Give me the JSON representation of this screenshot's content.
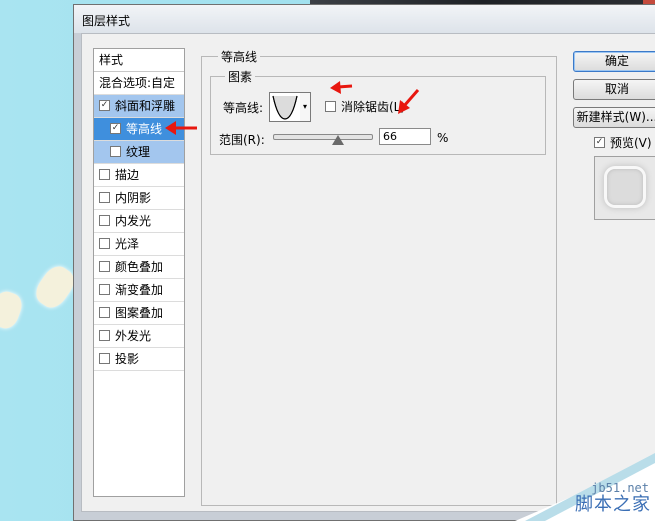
{
  "window": {
    "title": "图层样式"
  },
  "style_list": {
    "header": "样式",
    "blend_options": "混合选项:自定",
    "items": [
      {
        "label": "斜面和浮雕",
        "checked": true,
        "selected": true,
        "sub": false
      },
      {
        "label": "等高线",
        "checked": true,
        "selected": true,
        "sub": true
      },
      {
        "label": "纹理",
        "checked": false,
        "selected": true,
        "sub": true
      },
      {
        "label": "描边",
        "checked": false,
        "selected": false,
        "sub": false
      },
      {
        "label": "内阴影",
        "checked": false,
        "selected": false,
        "sub": false
      },
      {
        "label": "内发光",
        "checked": false,
        "selected": false,
        "sub": false
      },
      {
        "label": "光泽",
        "checked": false,
        "selected": false,
        "sub": false
      },
      {
        "label": "颜色叠加",
        "checked": false,
        "selected": false,
        "sub": false
      },
      {
        "label": "渐变叠加",
        "checked": false,
        "selected": false,
        "sub": false
      },
      {
        "label": "图案叠加",
        "checked": false,
        "selected": false,
        "sub": false
      },
      {
        "label": "外发光",
        "checked": false,
        "selected": false,
        "sub": false
      },
      {
        "label": "投影",
        "checked": false,
        "selected": false,
        "sub": false
      }
    ]
  },
  "contour_panel": {
    "group_title": "等高线",
    "subgroup_title": "图素",
    "contour_label": "等高线:",
    "anti_alias_label": "消除锯齿(L)",
    "anti_alias_checked": false,
    "range_label": "范围(R):",
    "range_value": "66",
    "range_unit": "%",
    "range_fraction": 0.66
  },
  "buttons": {
    "ok": "确定",
    "cancel": "取消",
    "new_style": "新建样式(W)...",
    "preview_label": "预览(V)",
    "preview_checked": true
  },
  "watermark": {
    "site": "jb51.net",
    "name": "脚本之家"
  },
  "colors": {
    "annotation_red": "#e8170f",
    "selection_blue": "#3f8fdd",
    "selection_light": "#a3c6ee"
  }
}
